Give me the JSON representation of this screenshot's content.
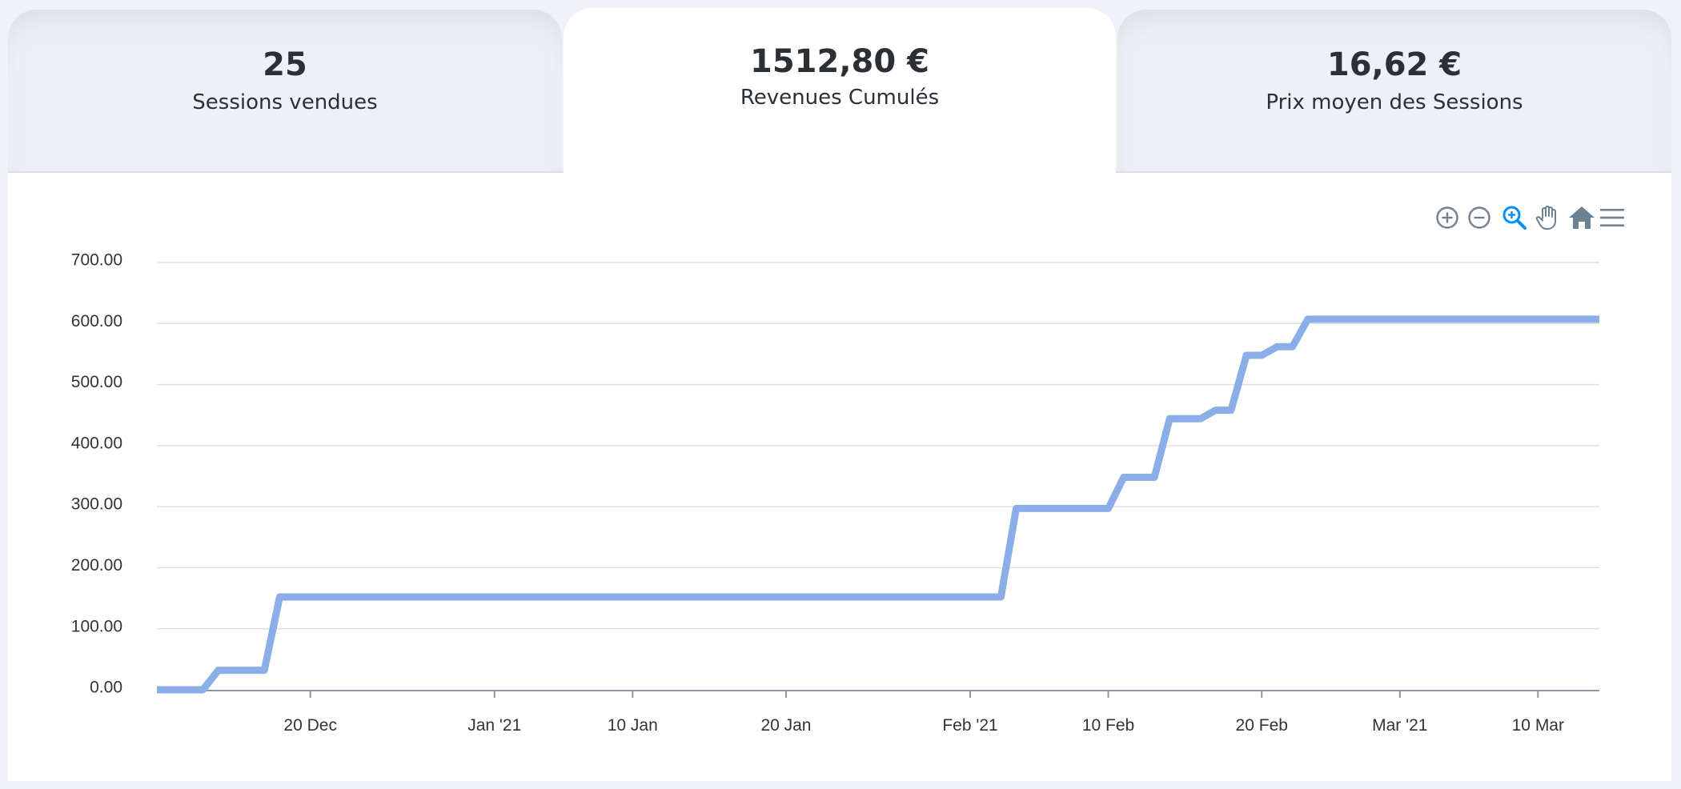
{
  "tabs": [
    {
      "value": "25",
      "label": "Sessions vendues",
      "active": false
    },
    {
      "value": "1512,80 €",
      "label": "Revenues Cumulés",
      "active": true
    },
    {
      "value": "16,62 €",
      "label": "Prix moyen des Sessions",
      "active": false
    }
  ],
  "toolbar": {
    "icons": [
      "zoom-in-icon",
      "zoom-out-icon",
      "selection-zoom-icon",
      "pan-hand-icon",
      "home-reset-icon",
      "menu-icon"
    ],
    "active_icon": "selection-zoom-icon"
  },
  "colors": {
    "line": "#8caee6",
    "grid": "#e0e0e0",
    "axis": "#8a96a8",
    "toolbar_icon": "#6e8192",
    "toolbar_active": "#008ffb",
    "text": "#2b2f36"
  },
  "chart_data": {
    "type": "line",
    "title": "",
    "xlabel": "",
    "ylabel": "",
    "x_domain": [
      "2020-12-10",
      "2021-03-14"
    ],
    "ylim": [
      0,
      700
    ],
    "y_ticks": [
      "0.00",
      "100.00",
      "200.00",
      "300.00",
      "400.00",
      "500.00",
      "600.00",
      "700.00"
    ],
    "x_ticks": [
      {
        "date": "2020-12-20",
        "label": "20 Dec"
      },
      {
        "date": "2021-01-01",
        "label": "Jan '21"
      },
      {
        "date": "2021-01-10",
        "label": "10 Jan"
      },
      {
        "date": "2021-01-20",
        "label": "20 Jan"
      },
      {
        "date": "2021-02-01",
        "label": "Feb '21"
      },
      {
        "date": "2021-02-10",
        "label": "10 Feb"
      },
      {
        "date": "2021-02-20",
        "label": "20 Feb"
      },
      {
        "date": "2021-03-01",
        "label": "Mar '21"
      },
      {
        "date": "2021-03-10",
        "label": "10 Mar"
      }
    ],
    "grid": true,
    "series": [
      {
        "points": [
          {
            "x": "2020-12-10",
            "y": 0
          },
          {
            "x": "2020-12-13",
            "y": 0
          },
          {
            "x": "2020-12-14",
            "y": 32
          },
          {
            "x": "2020-12-17",
            "y": 32
          },
          {
            "x": "2020-12-18",
            "y": 152
          },
          {
            "x": "2021-02-03",
            "y": 152
          },
          {
            "x": "2021-02-04",
            "y": 297
          },
          {
            "x": "2021-02-10",
            "y": 297
          },
          {
            "x": "2021-02-11",
            "y": 348
          },
          {
            "x": "2021-02-13",
            "y": 348
          },
          {
            "x": "2021-02-14",
            "y": 444
          },
          {
            "x": "2021-02-16",
            "y": 444
          },
          {
            "x": "2021-02-17",
            "y": 458
          },
          {
            "x": "2021-02-18",
            "y": 458
          },
          {
            "x": "2021-02-19",
            "y": 548
          },
          {
            "x": "2021-02-20",
            "y": 548
          },
          {
            "x": "2021-02-21",
            "y": 562
          },
          {
            "x": "2021-02-22",
            "y": 562
          },
          {
            "x": "2021-02-23",
            "y": 607
          },
          {
            "x": "2021-03-14",
            "y": 607
          }
        ]
      }
    ]
  }
}
